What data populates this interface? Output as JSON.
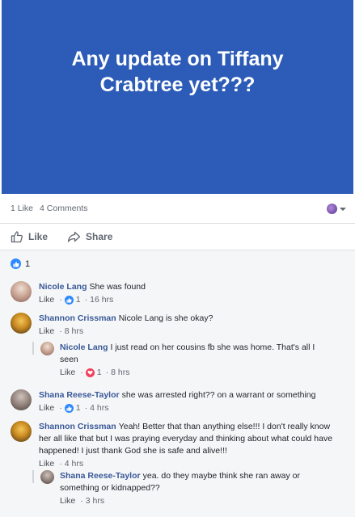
{
  "post": {
    "banner_text": "Any update on Tiffany Crabtree yet???",
    "likes": "1 Like",
    "comments_count": "4 Comments",
    "like_label": "Like",
    "share_label": "Share",
    "reaction_count": "1"
  },
  "comments": [
    {
      "author": "Nicole Lang",
      "text": "She was found",
      "like": "Like",
      "reaction_count": "1",
      "time": "16 hrs"
    },
    {
      "author": "Shannon Crissman",
      "text": "Nicole Lang is she okay?",
      "like": "Like",
      "time": "8 hrs",
      "replies": [
        {
          "author": "Nicole Lang",
          "text": "I just read on her cousins fb she was home. That's all I seen",
          "like": "Like",
          "reaction_count": "1",
          "time": "8 hrs"
        }
      ]
    },
    {
      "author": "Shana Reese-Taylor",
      "text": "she was arrested right?? on a warrant or something",
      "like": "Like",
      "reaction_count": "1",
      "time": "4 hrs"
    },
    {
      "author": "Shannon Crissman",
      "text": "Yeah! Better that than anything else!!! I don't really know her all like that but I was praying everyday and thinking about what could have happened! I just thank God she is safe and alive!!!",
      "like": "Like",
      "time": "4 hrs",
      "replies": [
        {
          "author": "Shana Reese-Taylor",
          "text": "yea. do they maybe think she ran away or something or kidnapped??",
          "like": "Like",
          "time": "3 hrs"
        }
      ]
    }
  ],
  "colors": {
    "banner": "#2c5cb8",
    "author": "#385898",
    "like_reaction": "#2d88ff",
    "love_reaction": "#f33e58"
  },
  "icons": [
    "thumbs-up-icon",
    "share-arrow-icon",
    "like-reaction-icon",
    "love-reaction-icon",
    "caret-down-icon"
  ]
}
